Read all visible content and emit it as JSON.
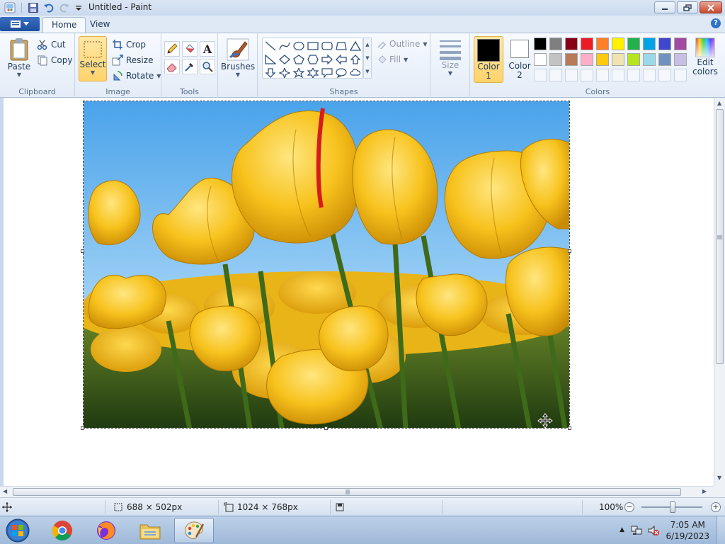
{
  "window": {
    "title": "Untitled - Paint"
  },
  "tabs": [
    {
      "label": "Home"
    },
    {
      "label": "View"
    }
  ],
  "clipboard": {
    "paste_label": "Paste",
    "cut_label": "Cut",
    "copy_label": "Copy",
    "group_label": "Clipboard"
  },
  "image_group": {
    "select_label": "Select",
    "crop_label": "Crop",
    "resize_label": "Resize",
    "rotate_label": "Rotate",
    "group_label": "Image"
  },
  "tools_group": {
    "group_label": "Tools",
    "text_tool_glyph": "A"
  },
  "brushes": {
    "label": "Brushes"
  },
  "shapes_group": {
    "outline_label": "Outline",
    "fill_label": "Fill",
    "group_label": "Shapes"
  },
  "size": {
    "label": "Size"
  },
  "colors": {
    "color1_label_line1": "Color",
    "color1_label_line2": "1",
    "color2_label_line1": "Color",
    "color2_label_line2": "2",
    "color1_value": "#000000",
    "color2_value": "#ffffff",
    "edit_label_line1": "Edit",
    "edit_label_line2": "colors",
    "group_label": "Colors",
    "palette": [
      "#000000",
      "#7f7f7f",
      "#880015",
      "#ed1c24",
      "#ff7f27",
      "#fff200",
      "#22b14c",
      "#00a2e8",
      "#3f48cc",
      "#a349a4",
      "#ffffff",
      "#c3c3c3",
      "#b97a57",
      "#ffaec9",
      "#ffc90e",
      "#efe4b0",
      "#b5e61d",
      "#99d9ea",
      "#7092be",
      "#c8bfe7",
      "",
      "",
      "",
      "",
      "",
      "",
      "",
      "",
      "",
      ""
    ]
  },
  "status": {
    "selection_size": "688 × 502px",
    "image_size": "1024 × 768px",
    "zoom": "100%"
  },
  "taskbar": {
    "time": "7:05 AM",
    "date": "6/19/2023"
  }
}
